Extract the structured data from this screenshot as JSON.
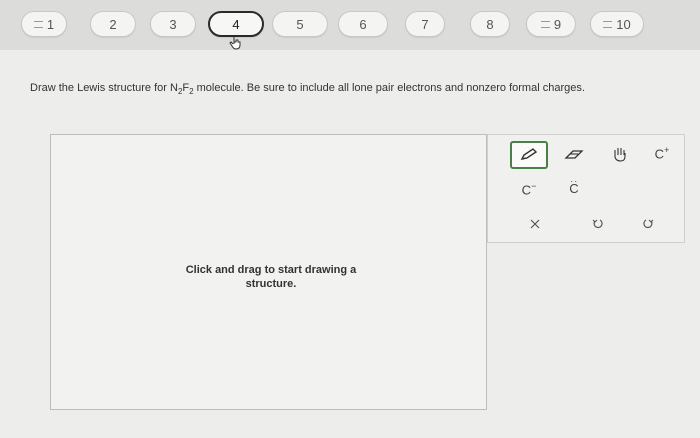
{
  "nav": {
    "questions": [
      {
        "label": "1",
        "flagged": true
      },
      {
        "label": "2",
        "flagged": false
      },
      {
        "label": "3",
        "flagged": false
      },
      {
        "label": "4",
        "flagged": false,
        "active": true
      },
      {
        "label": "5",
        "flagged": false
      },
      {
        "label": "6",
        "flagged": false
      },
      {
        "label": "7",
        "flagged": false
      },
      {
        "label": "8",
        "flagged": false
      },
      {
        "label": "9",
        "flagged": true
      },
      {
        "label": "10",
        "flagged": true
      }
    ]
  },
  "question": {
    "prompt_before": "Draw the Lewis structure for N",
    "sub1": "2",
    "mid": "F",
    "sub2": "2",
    "prompt_after": " molecule. Be sure to include all lone pair electrons and nonzero formal charges."
  },
  "canvas": {
    "hint": "Click and drag to start drawing a structure."
  },
  "toolbox": {
    "negative_charge_label": "C",
    "negative_charge_sup": "−",
    "lone_pair_label": "C",
    "positive_charge_label": "C",
    "positive_charge_sup": "+",
    "accent_color": "#4a7f47",
    "icons": [
      "pencil-icon",
      "eraser-icon",
      "hand-icon",
      "positive-charge-icon",
      "negative-charge-icon",
      "lone-pair-icon",
      "clear-icon",
      "undo-icon",
      "redo-icon"
    ]
  }
}
